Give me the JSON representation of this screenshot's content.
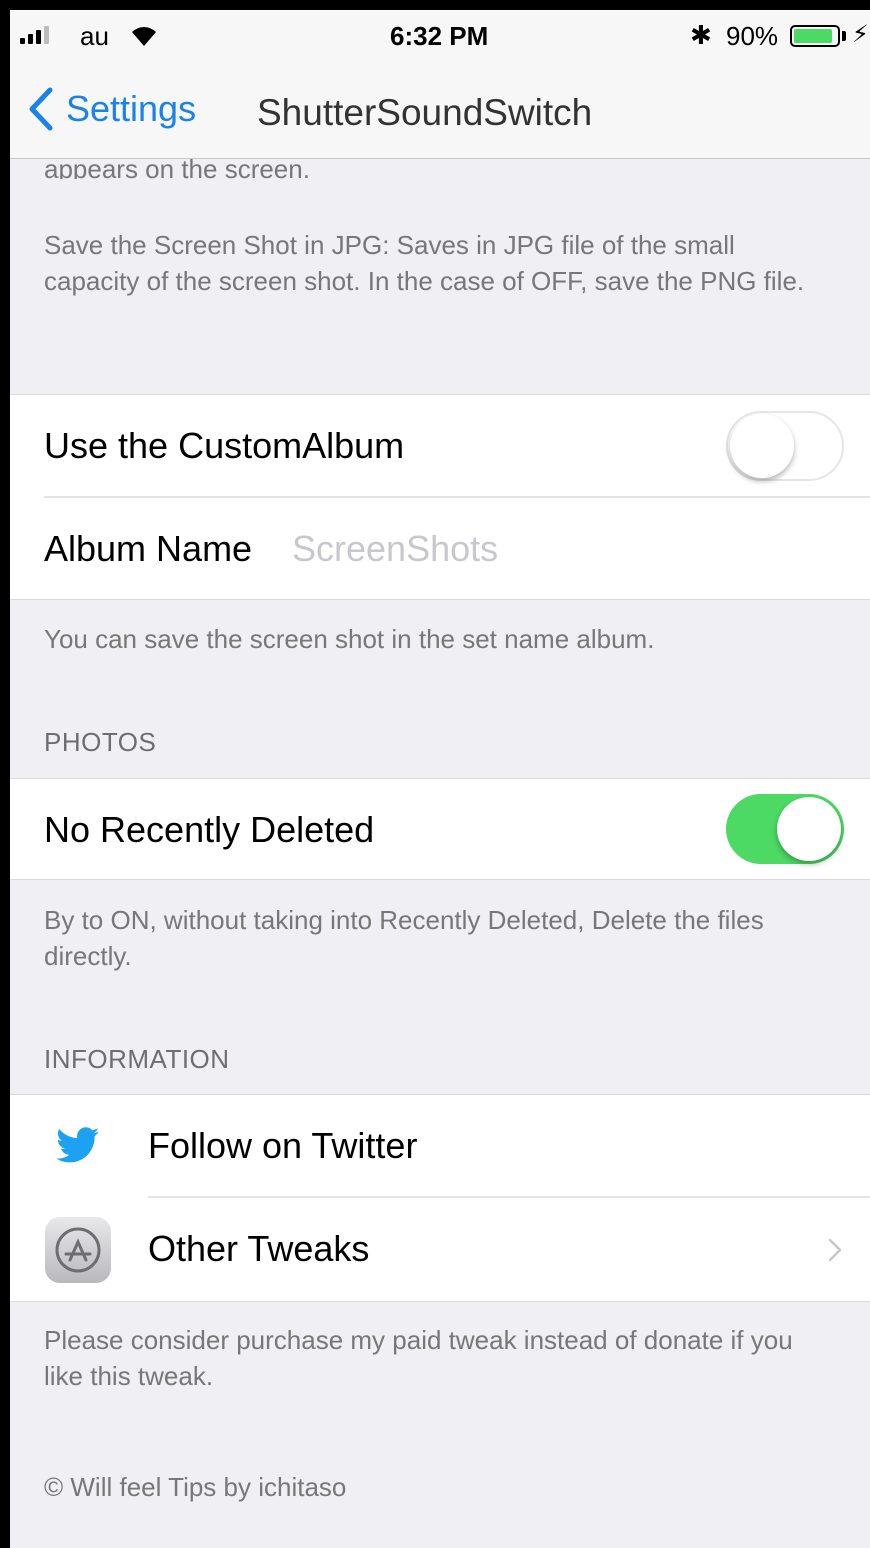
{
  "status_bar": {
    "carrier": "au",
    "time": "6:32 PM",
    "bluetooth": "✱",
    "battery_percent": "90%",
    "battery_level": 0.9,
    "charging_icon": "⚡"
  },
  "nav": {
    "back_label": "Settings",
    "title": "ShutterSoundSwitch"
  },
  "intro": {
    "clipped_text": "appears on the screen.",
    "jpg_description": "Save the Screen Shot in JPG: Saves in JPG file of the small capacity of the screen shot. In the case of OFF, save the PNG file."
  },
  "custom_album": {
    "toggle_label": "Use the CustomAlbum",
    "toggle_on": false,
    "album_label": "Album Name",
    "album_placeholder": "ScreenShots",
    "footer": "You can save the screen shot in the set name album."
  },
  "photos": {
    "header": "PHOTOS",
    "toggle_label": "No Recently Deleted",
    "toggle_on": true,
    "footer": "By to ON, without taking into Recently Deleted, Delete the files directly."
  },
  "information": {
    "header": "INFORMATION",
    "twitter_label": "Follow on Twitter",
    "other_tweaks_label": "Other Tweaks",
    "footer": "Please consider purchase my paid tweak instead of donate if you like this tweak.",
    "copyright": "© Will feel Tips by ichitaso"
  },
  "colors": {
    "accent": "#1a82e8",
    "switch_on": "#4cd964",
    "background": "#efeff4"
  }
}
